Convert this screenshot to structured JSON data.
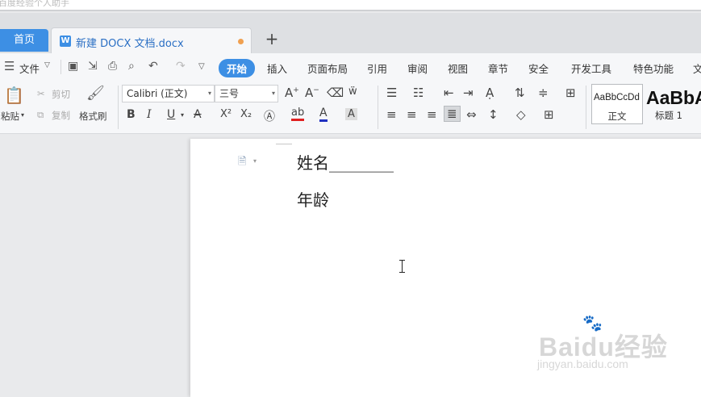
{
  "window": {
    "top_text": "百度经验个人助手"
  },
  "tabs": {
    "home": "首页",
    "document": "新建 DOCX 文档.docx",
    "new_tab": "+",
    "doc_icon": "W"
  },
  "menu": {
    "items": [
      "文件",
      "开始",
      "插入",
      "页面布局",
      "引用",
      "审阅",
      "视图",
      "章节",
      "安全",
      "开发工具",
      "特色功能",
      "文"
    ],
    "active": "开始"
  },
  "ribbon": {
    "paste": "粘贴",
    "cut": "剪切",
    "copy": "复制",
    "format_painter": "格式刷",
    "font_name": "Calibri (正文)",
    "font_size": "三号",
    "bold": "B",
    "italic": "I",
    "underline": "U",
    "superscript": "X²",
    "subscript": "X₂",
    "styles": [
      {
        "preview": "AaBbCcDd",
        "name": "正文"
      },
      {
        "preview": "AaBbA",
        "name": "标题 1"
      }
    ]
  },
  "document": {
    "line1": "姓名________",
    "line2": "年龄"
  },
  "watermark": {
    "logo": "Baidu经验",
    "url": "jingyan.baidu.com"
  },
  "colors": {
    "accent": "#3d8fe4",
    "modified_dot": "#f0a050"
  }
}
